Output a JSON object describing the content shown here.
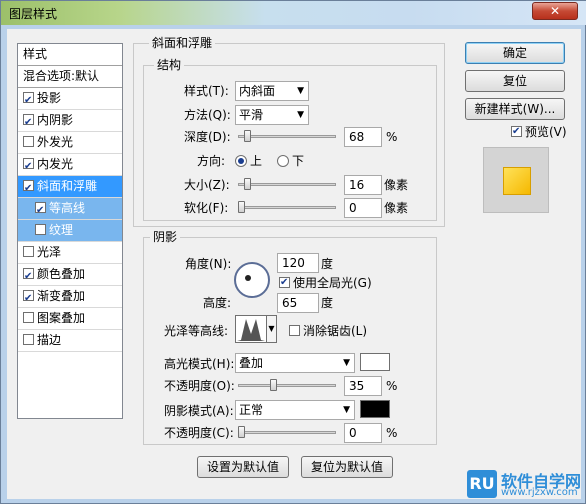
{
  "window": {
    "title": "图层样式",
    "close_label": "✕"
  },
  "left_list": {
    "header": "样式",
    "blend": "混合选项:默认",
    "items": [
      {
        "label": "投影",
        "checked": true
      },
      {
        "label": "内阴影",
        "checked": true
      },
      {
        "label": "外发光",
        "checked": false
      },
      {
        "label": "内发光",
        "checked": true
      },
      {
        "label": "斜面和浮雕",
        "checked": true
      },
      {
        "label": "等高线",
        "checked": true
      },
      {
        "label": "纹理",
        "checked": false
      },
      {
        "label": "光泽",
        "checked": false
      },
      {
        "label": "颜色叠加",
        "checked": true
      },
      {
        "label": "渐变叠加",
        "checked": true
      },
      {
        "label": "图案叠加",
        "checked": false
      },
      {
        "label": "描边",
        "checked": false
      }
    ]
  },
  "bevel": {
    "group_title": "斜面和浮雕",
    "structure_title": "结构",
    "style_label": "样式(T):",
    "style_value": "内斜面",
    "technique_label": "方法(Q):",
    "technique_value": "平滑",
    "depth_label": "深度(D):",
    "depth_value": "68",
    "depth_unit": "%",
    "depth_fraction": 0.068,
    "direction_label": "方向:",
    "direction_up": "上",
    "direction_down": "下",
    "size_label": "大小(Z):",
    "size_value": "16",
    "size_unit": "像素",
    "size_fraction": 0.065,
    "soften_label": "软化(F):",
    "soften_value": "0",
    "soften_unit": "像素",
    "soften_fraction": 0.0
  },
  "shading": {
    "title": "阴影",
    "angle_label": "角度(N):",
    "angle_value": "120",
    "angle_unit": "度",
    "global_light_label": "使用全局光(G)",
    "altitude_label": "高度:",
    "altitude_value": "65",
    "altitude_unit": "度",
    "gloss_label": "光泽等高线:",
    "antialias_label": "消除锯齿(L)",
    "highlight_mode_label": "高光模式(H):",
    "highlight_mode_value": "叠加",
    "highlight_color": "#ffffff",
    "highlight_opacity_label": "不透明度(O):",
    "highlight_opacity_value": "35",
    "highlight_opacity_unit": "%",
    "highlight_opacity_fraction": 0.35,
    "shadow_mode_label": "阴影模式(A):",
    "shadow_mode_value": "正常",
    "shadow_color": "#000000",
    "shadow_opacity_label": "不透明度(C):",
    "shadow_opacity_value": "0",
    "shadow_opacity_unit": "%",
    "shadow_opacity_fraction": 0.0
  },
  "buttons": {
    "ok": "确定",
    "reset": "复位",
    "new_style": "新建样式(W)...",
    "preview": "预览(V)",
    "make_default": "设置为默认值",
    "reset_default": "复位为默认值"
  },
  "watermark": {
    "logo": "RU",
    "text": "软件自学网",
    "url": "www.rjzxw.com"
  }
}
